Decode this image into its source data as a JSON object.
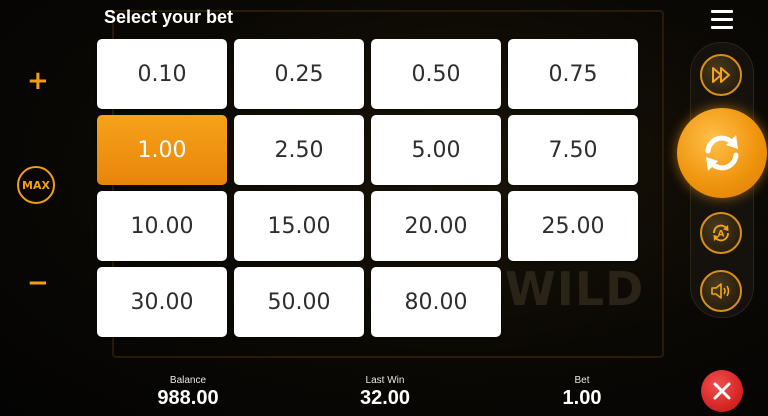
{
  "header": {
    "title": "Select your bet"
  },
  "bets": {
    "options": [
      "0.10",
      "0.25",
      "0.50",
      "0.75",
      "1.00",
      "2.50",
      "5.00",
      "7.50",
      "10.00",
      "15.00",
      "20.00",
      "25.00",
      "30.00",
      "50.00",
      "80.00"
    ],
    "selected": "1.00"
  },
  "left_controls": {
    "plus_label": "+",
    "max_label": "MAX",
    "minus_label": "−"
  },
  "background": {
    "wild_text": "WILD"
  },
  "footer": {
    "balance_label": "Balance",
    "balance_value": "988.00",
    "last_win_label": "Last Win",
    "last_win_value": "32.00",
    "bet_label": "Bet",
    "bet_value": "1.00"
  },
  "icons": {
    "menu": "menu-icon",
    "turbo": "fast-forward-icon",
    "spin": "refresh-icon",
    "autoplay": "autoplay-icon",
    "sound": "speaker-icon",
    "close": "close-icon"
  },
  "colors": {
    "accent": "#f29e15",
    "selected_bet": "#e8850b",
    "close_button": "#d32020"
  }
}
